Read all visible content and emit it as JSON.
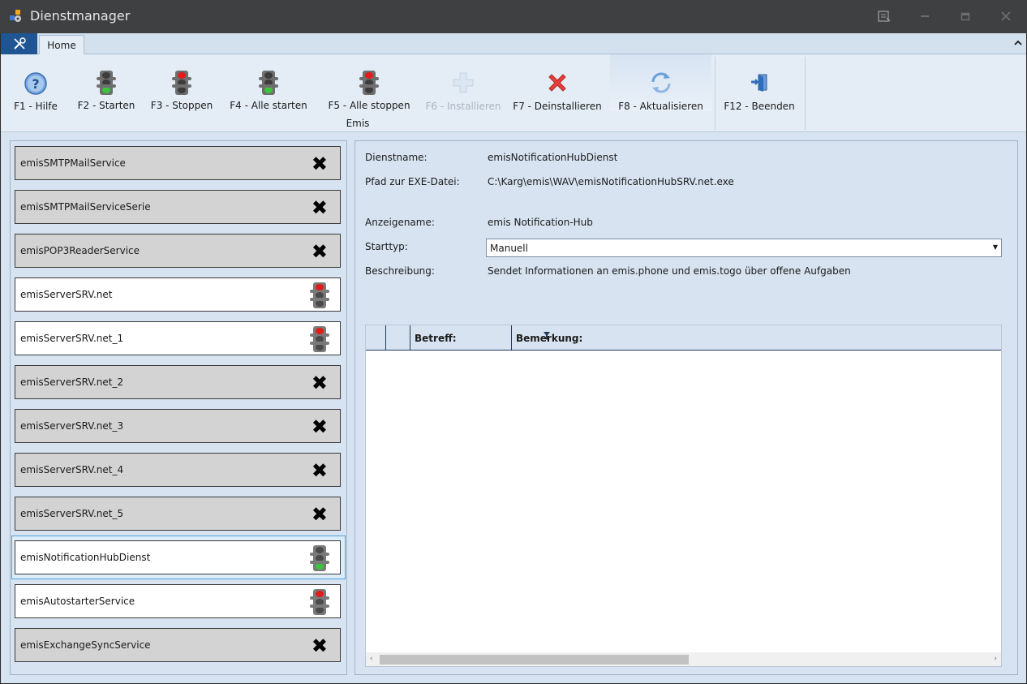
{
  "window": {
    "title": "Dienstmanager"
  },
  "tabs": {
    "home": "Home"
  },
  "ribbon": {
    "group_label": "Emis",
    "buttons": [
      {
        "label": "F1 - Hilfe",
        "icon": "help-icon",
        "enabled": true
      },
      {
        "label": "F2 - Starten",
        "icon": "traffic-light-green-icon",
        "enabled": true
      },
      {
        "label": "F3 - Stoppen",
        "icon": "traffic-light-red-icon",
        "enabled": true
      },
      {
        "label": "F4 - Alle starten",
        "icon": "traffic-light-green-icon",
        "enabled": true
      },
      {
        "label": "F5 - Alle stoppen",
        "icon": "traffic-light-red-icon",
        "enabled": true
      },
      {
        "label": "F6 - Installieren",
        "icon": "plus-icon",
        "enabled": false
      },
      {
        "label": "F7 - Deinstallieren",
        "icon": "delete-x-icon",
        "enabled": true
      },
      {
        "label": "F8 - Aktualisieren",
        "icon": "refresh-icon",
        "enabled": true
      },
      {
        "label": "F12 - Beenden",
        "icon": "exit-door-icon",
        "enabled": true
      }
    ]
  },
  "services": [
    {
      "name": "emisSMTPMailService",
      "state": "not-installed"
    },
    {
      "name": "emisSMTPMailServiceSerie",
      "state": "not-installed"
    },
    {
      "name": "emisPOP3ReaderService",
      "state": "not-installed"
    },
    {
      "name": "emisServerSRV.net",
      "state": "stopped"
    },
    {
      "name": "emisServerSRV.net_1",
      "state": "stopped"
    },
    {
      "name": "emisServerSRV.net_2",
      "state": "not-installed"
    },
    {
      "name": "emisServerSRV.net_3",
      "state": "not-installed"
    },
    {
      "name": "emisServerSRV.net_4",
      "state": "not-installed"
    },
    {
      "name": "emisServerSRV.net_5",
      "state": "not-installed"
    },
    {
      "name": "emisNotificationHubDienst",
      "state": "running",
      "selected": true
    },
    {
      "name": "emisAutostarterService",
      "state": "stopped"
    },
    {
      "name": "emisExchangeSyncService",
      "state": "not-installed"
    }
  ],
  "details": {
    "service_name_label": "Dienstname:",
    "service_name_value": "emisNotificationHubDienst",
    "exe_path_label": "Pfad zur EXE-Datei:",
    "exe_path_value": "C:\\Karg\\emis\\WAV\\emisNotificationHubSRV.net.exe",
    "display_name_label": "Anzeigename:",
    "display_name_value": "emis Notification-Hub",
    "start_type_label": "Starttyp:",
    "start_type_value": "Manuell",
    "description_label": "Beschreibung:",
    "description_value": "Sendet Informationen an emis.phone und emis.togo über offene Aufgaben"
  },
  "grid": {
    "columns": [
      "Betreff:",
      "Bemerkung:"
    ],
    "rows": []
  }
}
